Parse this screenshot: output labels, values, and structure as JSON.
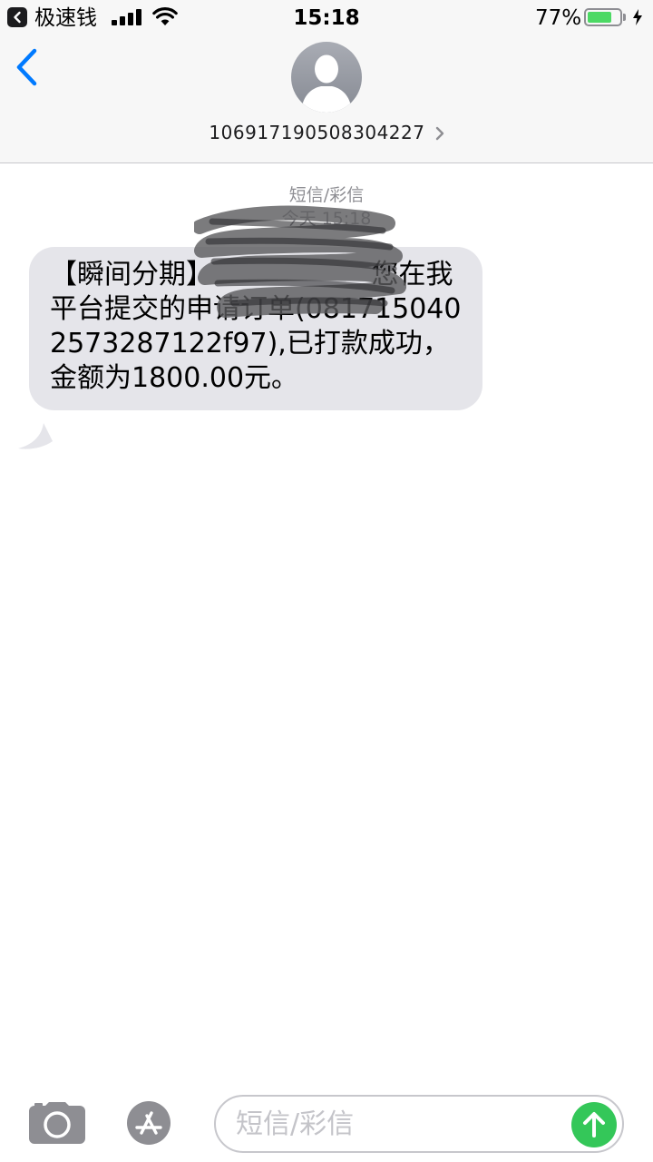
{
  "status_bar": {
    "back_app_label": "极速钱",
    "time": "15:18",
    "battery_percent": "77%",
    "battery_level": 0.77,
    "icons": [
      "back-app-icon",
      "signal-icon",
      "wifi-icon",
      "battery-icon",
      "charging-icon"
    ]
  },
  "header": {
    "back_icon": "chevron-left-icon",
    "avatar_icon": "person-silhouette-icon",
    "contact_number": "106917190508304227",
    "details_icon": "chevron-right-icon"
  },
  "thread": {
    "message_type": "短信/彩信",
    "timestamp": "今天 15:18"
  },
  "messages": [
    {
      "direction": "incoming",
      "text": "【瞬间分期】　　　　　　 您在我平台提交的申请订单(081715040257328712​2f97),已打款成功，金额为1800.00元。"
    }
  ],
  "input_bar": {
    "camera_icon": "camera-icon",
    "apps_icon": "app-store-icon",
    "placeholder": "短信/彩信",
    "value": "",
    "send_icon": "arrow-up-icon"
  },
  "colors": {
    "accent": "#007aff",
    "incoming_bubble": "#e5e5ea",
    "send": "#34c759",
    "battery": "#4cd964",
    "meta_text": "#8e8e93"
  }
}
